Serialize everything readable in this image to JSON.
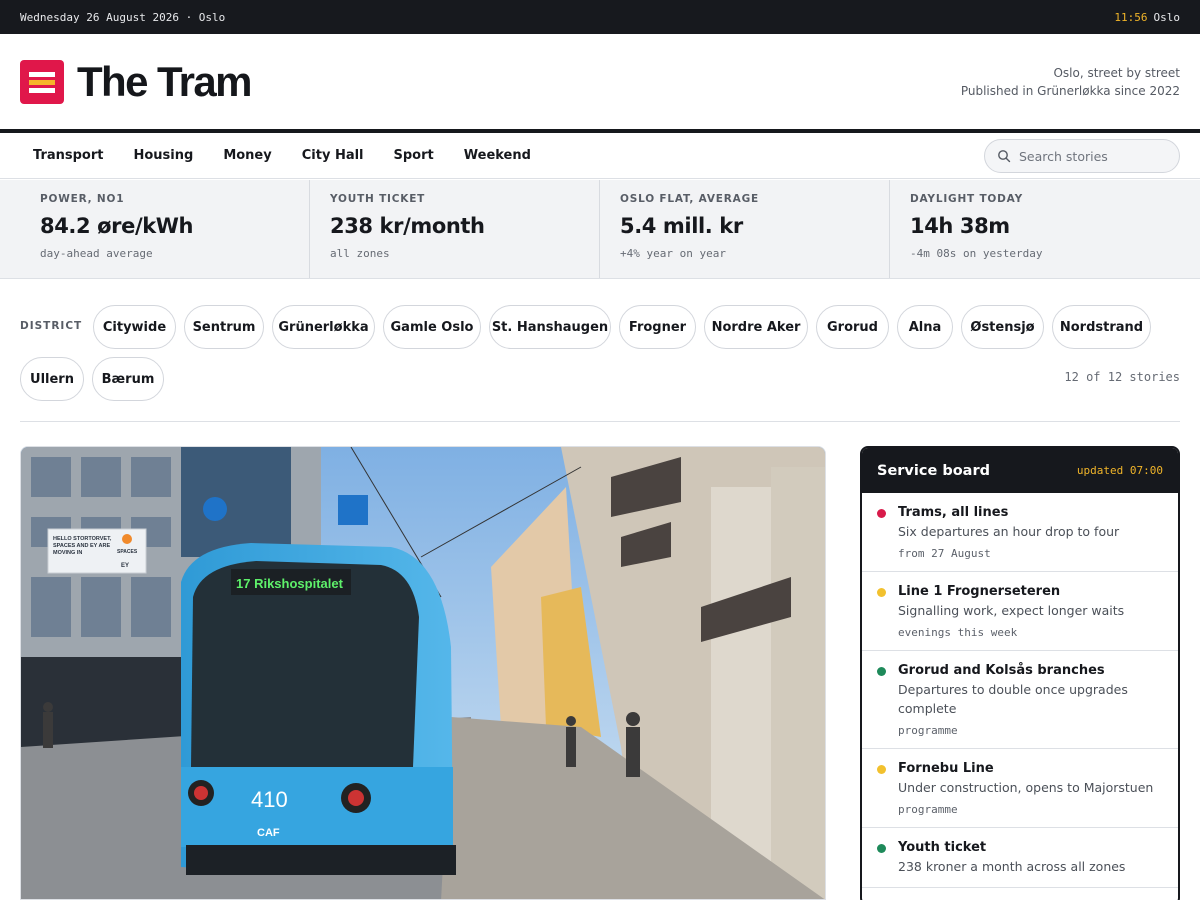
{
  "topbar": {
    "date_line": "Wednesday 26 August 2026 · Oslo",
    "time": "11:56",
    "city": "Oslo"
  },
  "masthead": {
    "brand": "The Tram",
    "tagline_1": "Oslo, street by street",
    "tagline_2": "Published in Grünerløkka since 2022"
  },
  "colors": {
    "brand_red": "#e0174a",
    "accent_amber": "#f0b429",
    "ink": "#16181d",
    "status_red": "#d81b4a",
    "status_amber": "#f2c12e",
    "status_green": "#1e8a5a"
  },
  "nav": {
    "items": [
      "Transport",
      "Housing",
      "Money",
      "City Hall",
      "Sport",
      "Weekend"
    ],
    "search_placeholder": "Search stories",
    "search_icon": "search-icon"
  },
  "stats": [
    {
      "label": "POWER, NO1",
      "value": "84.2 øre/kWh",
      "note": "day-ahead average"
    },
    {
      "label": "YOUTH TICKET",
      "value": "238 kr/month",
      "note": "all zones"
    },
    {
      "label": "OSLO FLAT, AVERAGE",
      "value": "5.4 mill. kr",
      "note": "+4% year on year"
    },
    {
      "label": "DAYLIGHT TODAY",
      "value": "14h 38m",
      "note": "-4m 08s on yesterday"
    }
  ],
  "district": {
    "label": "DISTRICT",
    "chips": [
      "Citywide",
      "Sentrum",
      "Grünerløkka",
      "Gamle Oslo",
      "St. Hanshaugen",
      "Frogner",
      "Nordre Aker",
      "Grorud",
      "Alna",
      "Østensjø",
      "Nordstrand",
      "Ullern",
      "Bærum"
    ],
    "count": "12 of 12 stories"
  },
  "hero": {
    "tram_destination": "17 Rikshospitalet",
    "tram_number": "410",
    "tram_maker": "CAF",
    "billboard_line_1": "HELLO STORTORVET,",
    "billboard_line_2": "SPACES AND EY ARE",
    "billboard_line_3": "MOVING IN",
    "billboard_brand": "SPACES",
    "billboard_brand_2": "EY"
  },
  "board": {
    "title": "Service board",
    "updated": "updated 07:00",
    "items": [
      {
        "title": "Trams, all lines",
        "desc": "Six departures an hour drop to four",
        "meta": "from 27 August",
        "status": "red"
      },
      {
        "title": "Line 1 Frognerseteren",
        "desc": "Signalling work, expect longer waits",
        "meta": "evenings this week",
        "status": "amber"
      },
      {
        "title": "Grorud and Kolsås branches",
        "desc": "Departures to double once upgrades complete",
        "meta": "programme",
        "status": "green"
      },
      {
        "title": "Fornebu Line",
        "desc": "Under construction, opens to Majorstuen",
        "meta": "programme",
        "status": "amber"
      },
      {
        "title": "Youth ticket",
        "desc": "238 kroner a month across all zones",
        "meta": "",
        "status": "green"
      }
    ]
  }
}
